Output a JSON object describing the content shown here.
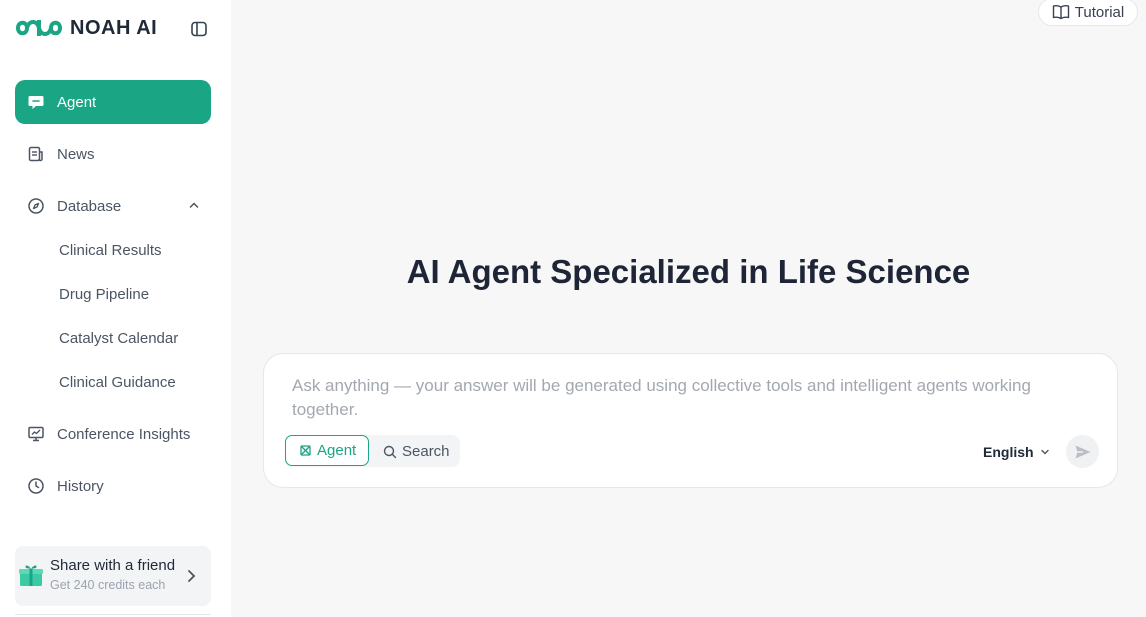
{
  "brand": {
    "name": "NOAH AI",
    "logo_icon": "infinity-logo-icon",
    "accent": "#1aa585"
  },
  "sidebar": {
    "nav": [
      {
        "label": "Agent",
        "icon": "chat-bubble-icon",
        "active": true
      },
      {
        "label": "News",
        "icon": "newspaper-icon"
      },
      {
        "label": "Database",
        "icon": "compass-icon",
        "expanded": true
      },
      {
        "label": "Conference Insights",
        "icon": "presentation-icon"
      },
      {
        "label": "History",
        "icon": "clock-icon"
      }
    ],
    "database_items": [
      "Clinical Results",
      "Drug Pipeline",
      "Catalyst Calendar",
      "Clinical Guidance"
    ],
    "share": {
      "title": "Share with a friend",
      "subtitle": "Get 240 credits each"
    }
  },
  "header": {
    "tutorial_label": "Tutorial"
  },
  "main": {
    "title": "AI Agent Specialized in Life Science",
    "input": {
      "value": "",
      "placeholder": "Ask anything — your answer will be generated using collective tools and intelligent agents working together."
    },
    "modes": [
      {
        "label": "Agent",
        "selected": true
      },
      {
        "label": "Search",
        "selected": false
      }
    ],
    "language": "English"
  }
}
